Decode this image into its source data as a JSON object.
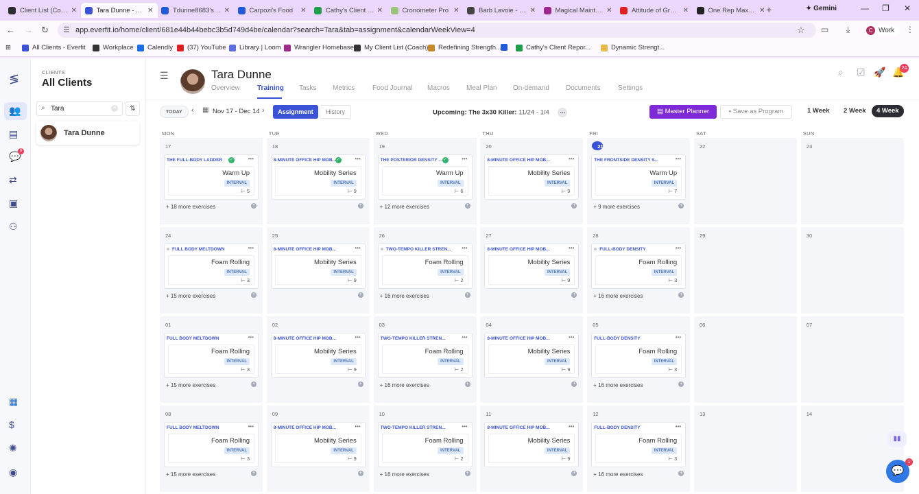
{
  "browser": {
    "tabs": [
      {
        "title": "Client List (Coach)",
        "color": "#2b2d33"
      },
      {
        "title": "Tara Dunne - Training",
        "color": "#3a52d6"
      },
      {
        "title": "Tdunne8683's Food",
        "color": "#1f5bd8"
      },
      {
        "title": "Carpozi's Food",
        "color": "#1f5bd8"
      },
      {
        "title": "Cathy's Client Report",
        "color": "#1e9e4a"
      },
      {
        "title": "Cronometer Pro",
        "color": "#9bc27a"
      },
      {
        "title": "Barb Lavoie - Workout",
        "color": "#444444"
      },
      {
        "title": "Magical Maintenance",
        "color": "#9c2a8e"
      },
      {
        "title": "Attitude of Gratitude",
        "color": "#e02020"
      },
      {
        "title": "One Rep Max Calc",
        "color": "#222222"
      }
    ],
    "new_tab": "+",
    "gemini_label": "Gemini",
    "minimize": "—",
    "restore": "❐",
    "close": "✕",
    "url": "app.everfit.io/home/client/681e44b44bebc3b5d749d4be/calendar?search=Tara&tab=assignment&calendarWeekView=4",
    "profile_label": "Work",
    "profile_initial": "C",
    "bookmarks": [
      {
        "label": "All Clients - Everfit",
        "color": "#3a52d6"
      },
      {
        "label": "Workplace",
        "color": "#333333"
      },
      {
        "label": "Calendly",
        "color": "#1a6ce8"
      },
      {
        "label": "(37) YouTube",
        "color": "#e02020"
      },
      {
        "label": "Library | Loom",
        "color": "#5b6ee1"
      },
      {
        "label": "Wrangler Homebase",
        "color": "#9c2a8e"
      },
      {
        "label": "My Client List (Coach)",
        "color": "#333333"
      },
      {
        "label": "Redefining Strength...",
        "color": "#c48a2a"
      },
      {
        "label": "",
        "color": "#1f5bd8"
      },
      {
        "label": "Cathy's Client Repor...",
        "color": "#1e9e4a"
      },
      {
        "label": "Dynamic Strengt...",
        "color": "#e8b84a"
      }
    ]
  },
  "rail": {
    "icons": [
      "logo-icon",
      "clients-icon",
      "library-icon",
      "chat-icon",
      "workflow-icon",
      "folder-icon",
      "team-icon",
      "calendar-icon",
      "dollar-icon",
      "integrations-icon",
      "profile-icon"
    ],
    "chat_badge": "6"
  },
  "clients": {
    "section_label": "CLIENTS",
    "title": "All Clients",
    "search_value": "Tara",
    "list": [
      {
        "name": "Tara Dunne"
      }
    ]
  },
  "header": {
    "client_name": "Tara Dunne",
    "tabs": [
      "Overview",
      "Training",
      "Tasks",
      "Metrics",
      "Food Journal",
      "Macros",
      "Meal Plan",
      "On-demand",
      "Documents",
      "Settings"
    ],
    "active_tab": "Training",
    "notification_count": "24"
  },
  "toolbar": {
    "today_label": "TODAY",
    "date_range": "Nov 17 - Dec 14",
    "assignment_label": "Assignment",
    "history_label": "History",
    "upcoming_label": "Upcoming: The 3x30 Killer:",
    "upcoming_dates": "11/24 - 1/4",
    "master_planner_label": "Master Planner",
    "save_program_label": "Save as Program",
    "week_options": [
      "1 Week",
      "2 Week",
      "4 Week"
    ],
    "active_week_option": "4 Week"
  },
  "calendar": {
    "day_names": [
      "MON",
      "TUE",
      "WED",
      "THU",
      "FRI",
      "SAT",
      "SUN"
    ],
    "weeks": [
      {
        "days": [
          {
            "date": "17",
            "workout": {
              "title": "THE FULL-BODY LADDER",
              "done": true,
              "section": "Warm Up",
              "tag": "INTERVAL",
              "count": "5",
              "more": "+ 18 more exercises"
            }
          },
          {
            "date": "18",
            "workout": {
              "title": "8-MINUTE OFFICE HIP MOB...",
              "done": true,
              "section": "Mobility Series",
              "tag": "INTERVAL",
              "count": "9",
              "more": ""
            }
          },
          {
            "date": "19",
            "workout": {
              "title": "THE POSTERIOR DENSITY ...",
              "done": true,
              "section": "Warm Up",
              "tag": "INTERVAL",
              "count": "6",
              "more": "+ 12 more exercises"
            }
          },
          {
            "date": "20",
            "workout": {
              "title": "8-MINUTE OFFICE HIP MOB...",
              "done": false,
              "section": "Mobility Series",
              "tag": "INTERVAL",
              "count": "9",
              "more": ""
            }
          },
          {
            "date": "21",
            "today": true,
            "workout": {
              "title": "THE FRONTSIDE DENSITY S...",
              "done": false,
              "section": "Warm Up",
              "tag": "INTERVAL",
              "count": "7",
              "more": "+ 9 more exercises"
            }
          },
          {
            "date": "22"
          },
          {
            "date": "23"
          }
        ]
      },
      {
        "days": [
          {
            "date": "24",
            "workout": {
              "title": "FULL BODY MELTDOWN",
              "dot": true,
              "section": "Foam Rolling",
              "tag": "INTERVAL",
              "count": "3",
              "more": "+ 15 more exercises"
            }
          },
          {
            "date": "25",
            "workout": {
              "title": "8-MINUTE OFFICE HIP MOB...",
              "section": "Mobility Series",
              "tag": "INTERVAL",
              "count": "9",
              "more": ""
            }
          },
          {
            "date": "26",
            "workout": {
              "title": "TWO-TEMPO KILLER STREN...",
              "dot": true,
              "section": "Foam Rolling",
              "tag": "INTERVAL",
              "count": "2",
              "more": "+ 16 more exercises"
            }
          },
          {
            "date": "27",
            "workout": {
              "title": "8-MINUTE OFFICE HIP MOB...",
              "section": "Mobility Series",
              "tag": "INTERVAL",
              "count": "9",
              "more": ""
            }
          },
          {
            "date": "28",
            "workout": {
              "title": "FULL-BODY DENSITY",
              "dot": true,
              "section": "Foam Rolling",
              "tag": "INTERVAL",
              "count": "3",
              "more": "+ 16 more exercises"
            }
          },
          {
            "date": "29"
          },
          {
            "date": "30"
          }
        ]
      },
      {
        "days": [
          {
            "date": "01",
            "workout": {
              "title": "FULL BODY MELTDOWN",
              "section": "Foam Rolling",
              "tag": "INTERVAL",
              "count": "3",
              "more": "+ 15 more exercises"
            }
          },
          {
            "date": "02",
            "workout": {
              "title": "8-MINUTE OFFICE HIP MOB...",
              "section": "Mobility Series",
              "tag": "INTERVAL",
              "count": "9",
              "more": ""
            }
          },
          {
            "date": "03",
            "workout": {
              "title": "TWO-TEMPO KILLER STREN...",
              "section": "Foam Rolling",
              "tag": "INTERVAL",
              "count": "2",
              "more": "+ 16 more exercises"
            }
          },
          {
            "date": "04",
            "workout": {
              "title": "8-MINUTE OFFICE HIP MOB...",
              "section": "Mobility Series",
              "tag": "INTERVAL",
              "count": "9",
              "more": ""
            }
          },
          {
            "date": "05",
            "workout": {
              "title": "FULL-BODY DENSITY",
              "section": "Foam Rolling",
              "tag": "INTERVAL",
              "count": "3",
              "more": "+ 16 more exercises"
            }
          },
          {
            "date": "06"
          },
          {
            "date": "07"
          }
        ]
      },
      {
        "days": [
          {
            "date": "08",
            "workout": {
              "title": "FULL BODY MELTDOWN",
              "section": "Foam Rolling",
              "tag": "INTERVAL",
              "count": "3",
              "more": "+ 15 more exercises"
            }
          },
          {
            "date": "09",
            "workout": {
              "title": "8-MINUTE OFFICE HIP MOB...",
              "section": "Mobility Series",
              "tag": "INTERVAL",
              "count": "9",
              "more": ""
            }
          },
          {
            "date": "10",
            "workout": {
              "title": "TWO-TEMPO KILLER STREN...",
              "section": "Foam Rolling",
              "tag": "INTERVAL",
              "count": "2",
              "more": "+ 16 more exercises"
            }
          },
          {
            "date": "11",
            "workout": {
              "title": "8-MINUTE OFFICE HIP MOB...",
              "section": "Mobility Series",
              "tag": "INTERVAL",
              "count": "9",
              "more": ""
            }
          },
          {
            "date": "12",
            "workout": {
              "title": "FULL-BODY DENSITY",
              "section": "Foam Rolling",
              "tag": "INTERVAL",
              "count": "3",
              "more": "+ 16 more exercises"
            }
          },
          {
            "date": "13"
          },
          {
            "date": "14"
          }
        ]
      }
    ]
  },
  "support": {
    "chat_badge": "1"
  },
  "colors": {
    "accent": "#3a52d6",
    "master_planner": "#7f2ad8",
    "done": "#30b46c",
    "badge": "#ee3f5c"
  }
}
